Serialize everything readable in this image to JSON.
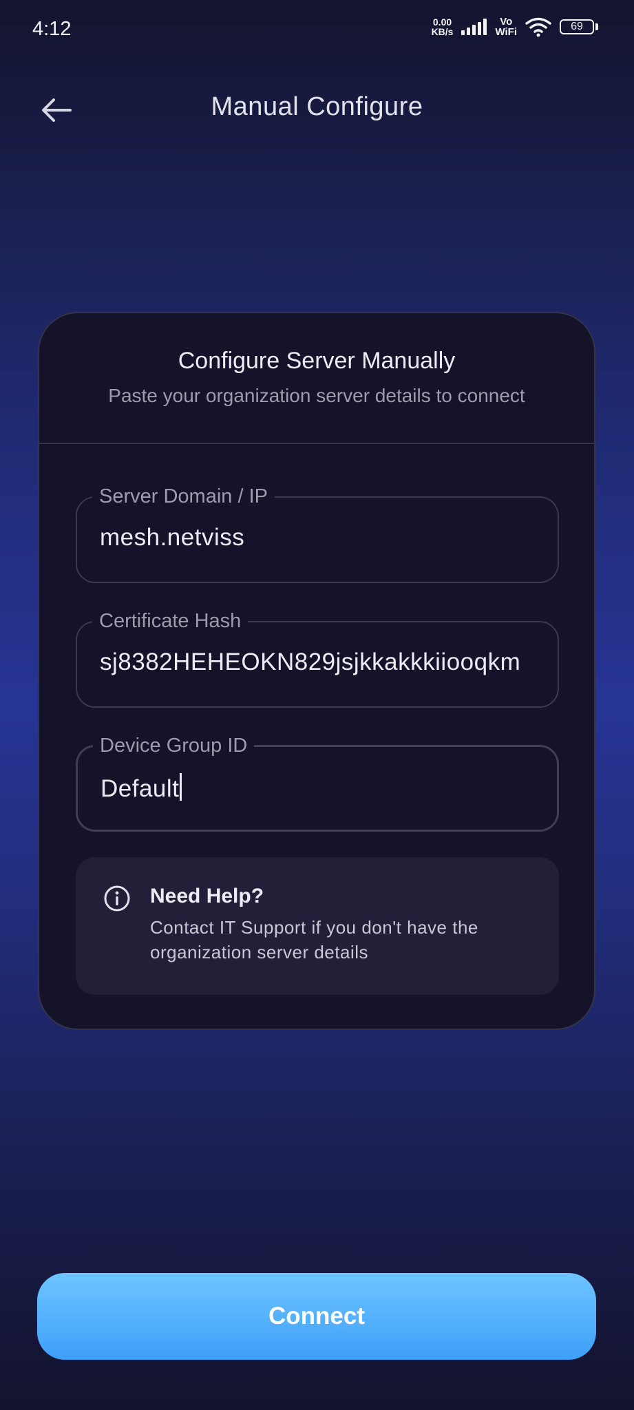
{
  "status_bar": {
    "time": "4:12",
    "net_speed_value": "0.00",
    "net_speed_unit": "KB/s",
    "vowifi_top": "Vo",
    "vowifi_bottom": "WiFi",
    "battery_level": "69"
  },
  "header": {
    "back_icon": "arrow-left-icon",
    "title": "Manual Configure"
  },
  "card": {
    "title": "Configure Server Manually",
    "subtitle": "Paste your organization server details to connect"
  },
  "fields": {
    "server": {
      "label": "Server Domain / IP",
      "value": "mesh.netviss"
    },
    "cert": {
      "label": "Certificate Hash",
      "value": "sj8382HEHEOKN829jsjkkakkkiiooqkm"
    },
    "group": {
      "label": "Device Group ID",
      "value": "Default"
    }
  },
  "help": {
    "icon": "info-icon",
    "title": "Need Help?",
    "text": "Contact IT Support if you don't have the organization server details"
  },
  "actions": {
    "connect_label": "Connect"
  },
  "colors": {
    "accent": "#4aa8fb",
    "card_bg": "#14132a",
    "help_bg": "#222038"
  }
}
